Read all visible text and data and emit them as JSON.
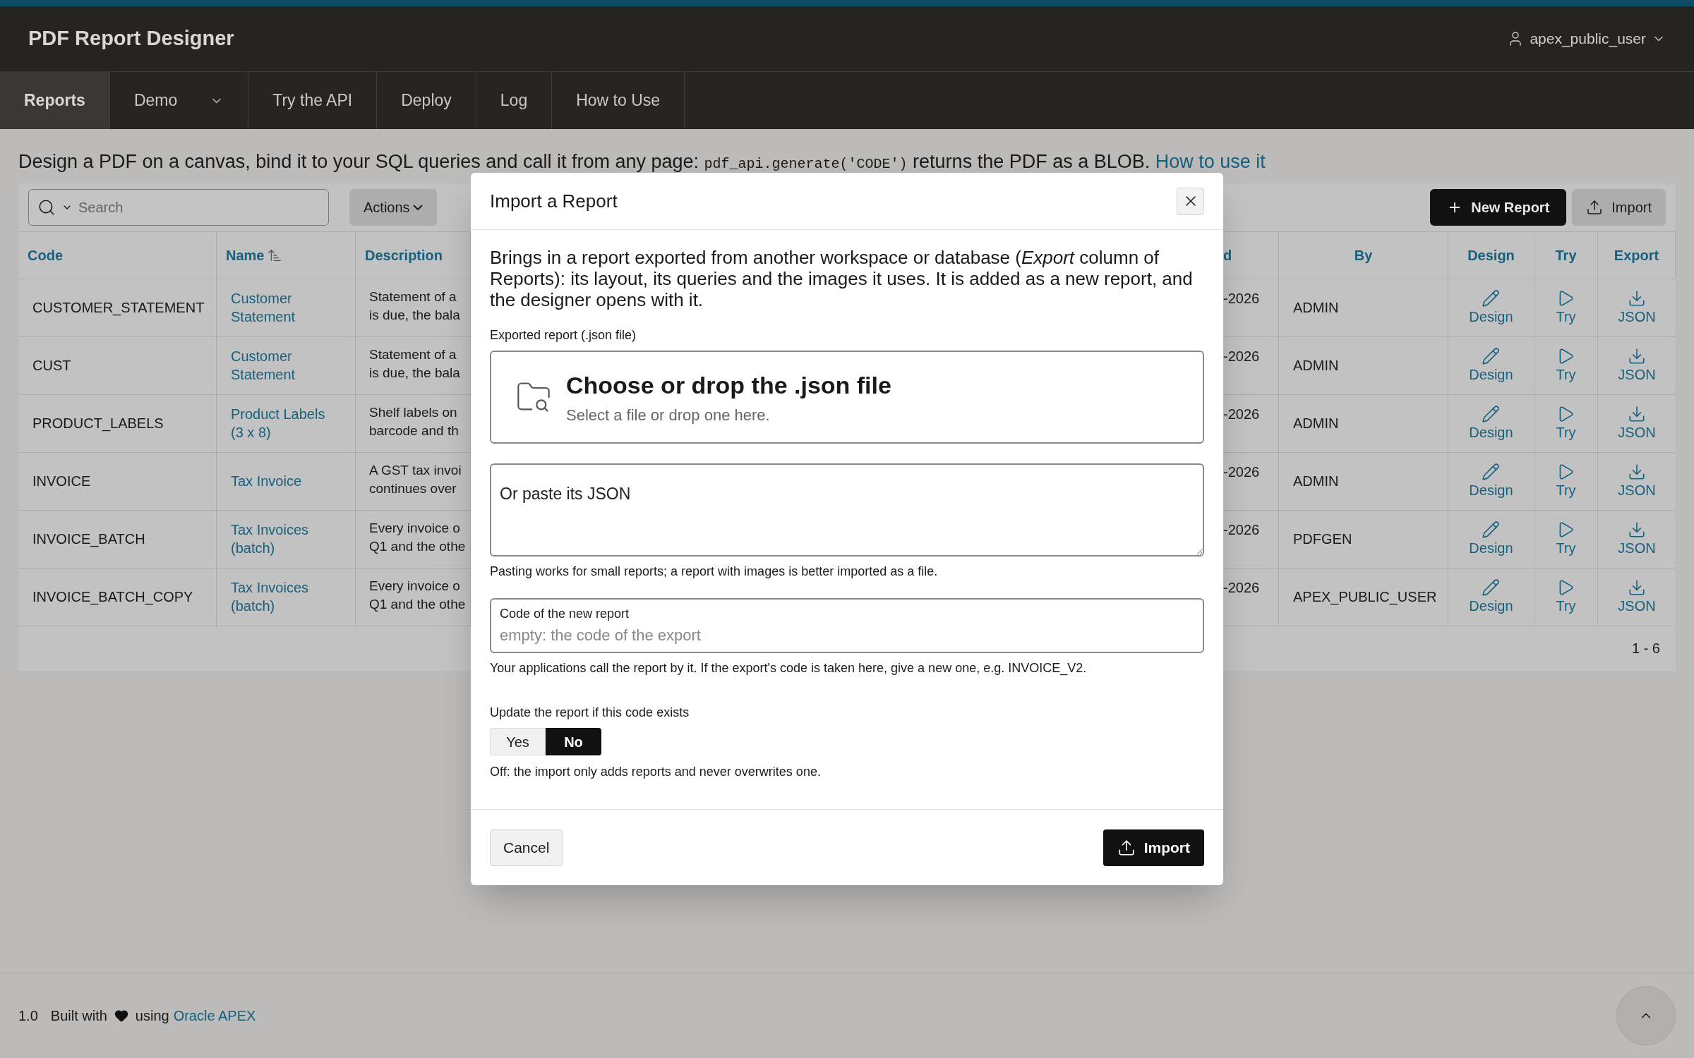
{
  "top_bar": {
    "app_title": "PDF Report Designer",
    "user": "apex_public_user"
  },
  "nav_tabs": [
    {
      "label": "Reports",
      "selected": true,
      "has_menu": false
    },
    {
      "label": "Demo",
      "selected": false,
      "has_menu": true
    },
    {
      "label": "Try the API",
      "selected": false,
      "has_menu": false
    },
    {
      "label": "Deploy",
      "selected": false,
      "has_menu": false
    },
    {
      "label": "Log",
      "selected": false,
      "has_menu": false
    },
    {
      "label": "How to Use",
      "selected": false,
      "has_menu": false
    }
  ],
  "intro": {
    "text": "Design a PDF on a canvas, bind it to your SQL queries and call it from any page:",
    "code": "pdf_api.generate('CODE')",
    "text_after": "returns the PDF as a BLOB.",
    "link": "How to use it"
  },
  "toolbar": {
    "search_placeholder": "Search",
    "actions_label": "Actions",
    "new_report_label": "New Report",
    "import_label": "Import"
  },
  "table": {
    "columns": [
      {
        "label": "Code",
        "sorted": false
      },
      {
        "label": "Name",
        "sorted": true
      },
      {
        "label": "Description",
        "sorted": false
      },
      {
        "label": "d",
        "sorted": false
      },
      {
        "label": "By",
        "sorted": false
      },
      {
        "label": "Design",
        "sorted": false
      },
      {
        "label": "Try",
        "sorted": false
      },
      {
        "label": "Export",
        "sorted": false
      }
    ],
    "rows": [
      {
        "code": "CUSTOMER_STATEMENT",
        "name": "Customer Statement",
        "description": [
          "Statement of a",
          "is due, the bala"
        ],
        "column_4": "-2026",
        "by": "ADMIN",
        "design": "Design",
        "try": "Try",
        "export": "JSON"
      },
      {
        "code": "CUST",
        "name": "Customer Statement",
        "description": [
          "Statement of a",
          "is due, the bala"
        ],
        "column_4": "-2026",
        "by": "ADMIN",
        "design": "Design",
        "try": "Try",
        "export": "JSON"
      },
      {
        "code": "PRODUCT_LABELS",
        "name": "Product Labels (3 x 8)",
        "description": [
          "Shelf labels on",
          "barcode and th"
        ],
        "column_4": "-2026",
        "by": "ADMIN",
        "design": "Design",
        "try": "Try",
        "export": "JSON"
      },
      {
        "code": "INVOICE",
        "name": "Tax Invoice",
        "description": [
          "A GST tax invoi",
          "continues over"
        ],
        "column_4": "-2026",
        "by": "ADMIN",
        "design": "Design",
        "try": "Try",
        "export": "JSON"
      },
      {
        "code": "INVOICE_BATCH",
        "name": "Tax Invoices (batch)",
        "description": [
          "Every invoice o",
          "Q1 and the othe"
        ],
        "column_4": "-2026",
        "by": "PDFGEN",
        "design": "Design",
        "try": "Try",
        "export": "JSON"
      },
      {
        "code": "INVOICE_BATCH_COPY",
        "name": "Tax Invoices (batch)",
        "description": [
          "Every invoice o",
          "Q1 and the othe"
        ],
        "column_4": "-2026",
        "by": "APEX_PUBLIC_USER",
        "design": "Design",
        "try": "Try",
        "export": "JSON"
      }
    ],
    "pagination": "1 - 6"
  },
  "dialog": {
    "title": "Import a Report",
    "intro": "Brings in a report exported from another workspace or database (*Export* column of Reports): its layout, its queries and the images it uses. It is added as a new report, and the designer opens with it.",
    "file_label": "Exported report (.json file)",
    "drop_title": "Choose or drop the .json file",
    "drop_hint": "Select a file or drop one here.",
    "paste_placeholder": "Or paste its JSON",
    "paste_help": "Pasting works for small reports; a report with images is better imported as a file.",
    "code_label": "Code of the new report",
    "code_placeholder": "empty: the code of the export",
    "code_help": "Your applications call the report by it. If the export's code is taken here, give a new one, e.g. INVOICE_V2.",
    "update_label": "Update the report if this code exists",
    "update_options": [
      {
        "label": "Yes",
        "selected": false
      },
      {
        "label": "No",
        "selected": true
      }
    ],
    "update_help": "Off: the import only adds reports and never overwrites one.",
    "cancel_label": "Cancel",
    "import_label": "Import"
  },
  "footer": {
    "version": "1.0",
    "built_with": "Built with",
    "using": "using",
    "link": "Oracle APEX"
  }
}
